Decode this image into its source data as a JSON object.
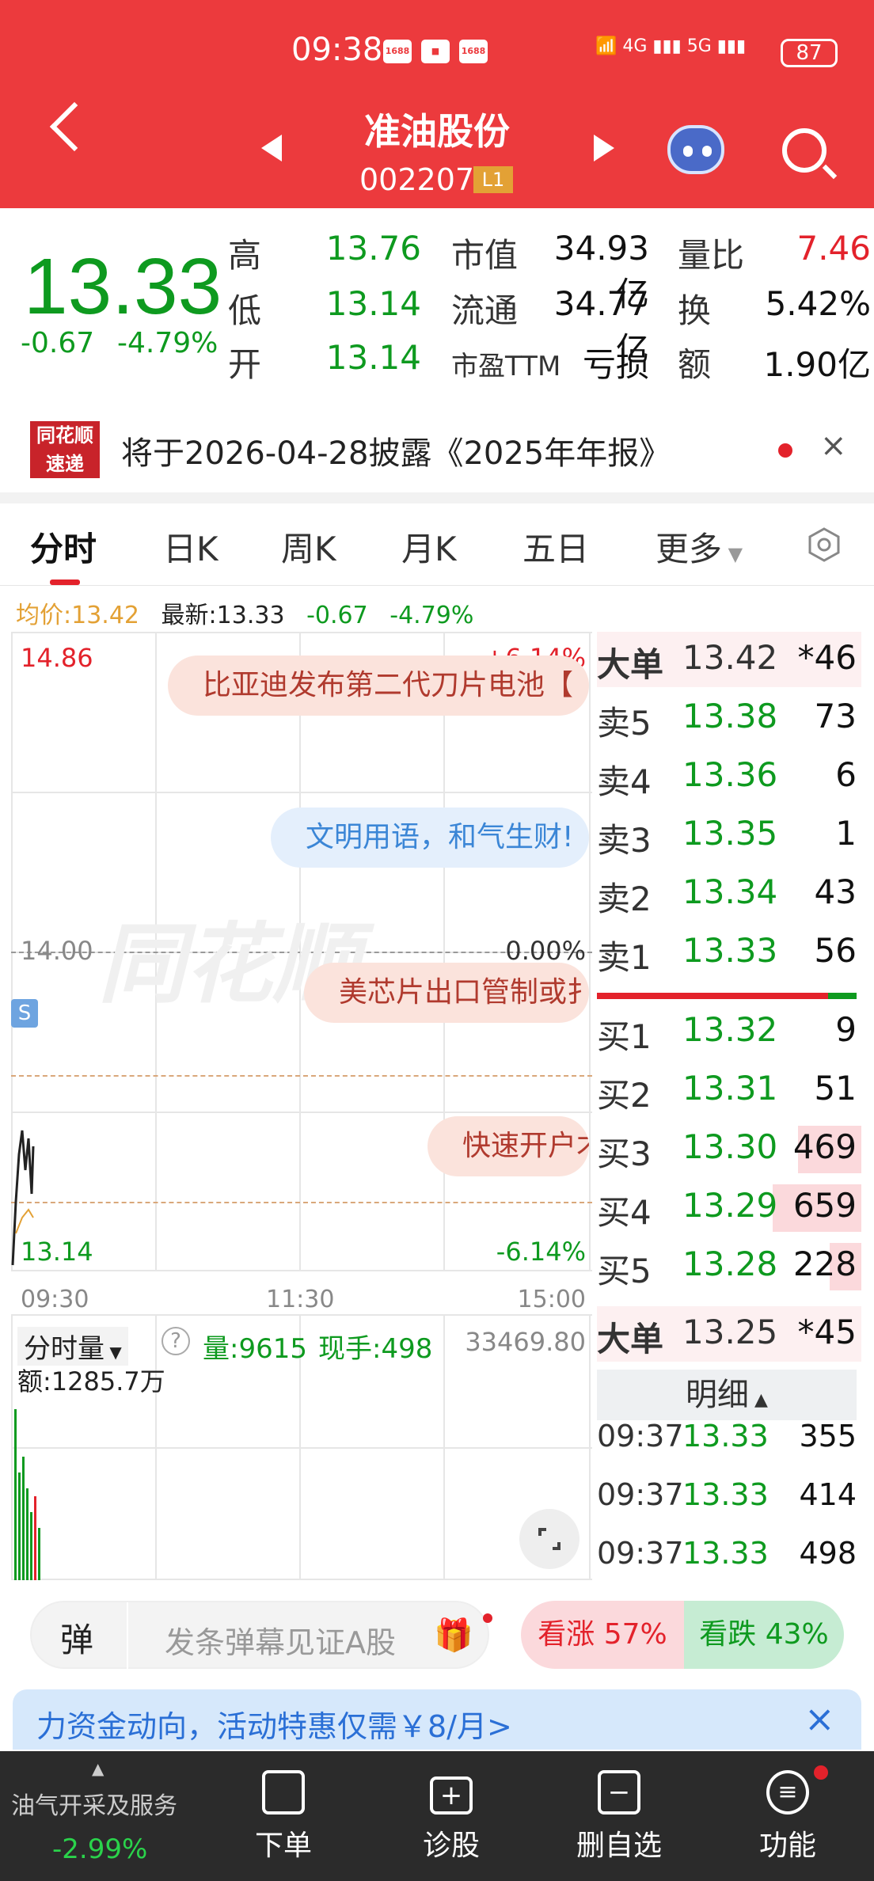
{
  "status": {
    "time": "09:38",
    "badge1": "1688",
    "badge2": "1688",
    "signal": "5G",
    "battery": "87"
  },
  "header": {
    "name": "准油股份",
    "code": "002207",
    "level": "L1"
  },
  "quote": {
    "price": "13.33",
    "change": "-0.67",
    "change_pct": "-4.79%",
    "high_label": "高",
    "high": "13.76",
    "low_label": "低",
    "low": "13.14",
    "open_label": "开",
    "open": "13.14",
    "mcap_label": "市值",
    "mcap": "34.93亿",
    "float_label": "流通",
    "float": "34.77亿",
    "pe_label": "市盈TTM",
    "pe": "亏损",
    "volratio_label": "量比",
    "volratio": "7.46",
    "turnover_label": "换",
    "turnover": "5.42%",
    "amount_label": "额",
    "amount": "1.90亿"
  },
  "notice": {
    "logo_top": "同花顺",
    "logo_bottom": "速递",
    "text": "将于2026-04-28披露《2025年年报》"
  },
  "tabs": [
    "分时",
    "日K",
    "周K",
    "月K",
    "五日",
    "更多"
  ],
  "info": {
    "avg_label": "均价:13.42",
    "latest": "最新:13.33",
    "chg": "-0.67",
    "pct": "-4.79%"
  },
  "chart": {
    "high": "14.86",
    "high_pct": "+6.14%",
    "mid": "14.00",
    "mid_pct": "0.00%",
    "low": "13.14",
    "low_pct": "-6.14%",
    "t_start": "09:30",
    "t_mid": "11:30",
    "t_end": "15:00",
    "marker": "S",
    "bubbles": [
      "比亚迪发布第二代刀片电池【",
      "文明用语，和气生财!",
      "美芯片出口管制或扌",
      "快速开户才"
    ]
  },
  "book": {
    "bigsell_label": "大单",
    "bigsell_price": "13.42",
    "bigsell_vol": "*46",
    "asks": [
      {
        "l": "卖5",
        "p": "13.38",
        "v": "73"
      },
      {
        "l": "卖4",
        "p": "13.36",
        "v": "6"
      },
      {
        "l": "卖3",
        "p": "13.35",
        "v": "1"
      },
      {
        "l": "卖2",
        "p": "13.34",
        "v": "43"
      },
      {
        "l": "卖1",
        "p": "13.33",
        "v": "56"
      }
    ],
    "bids": [
      {
        "l": "买1",
        "p": "13.32",
        "v": "9"
      },
      {
        "l": "买2",
        "p": "13.31",
        "v": "51"
      },
      {
        "l": "买3",
        "p": "13.30",
        "v": "469"
      },
      {
        "l": "买4",
        "p": "13.29",
        "v": "659"
      },
      {
        "l": "买5",
        "p": "13.28",
        "v": "228"
      }
    ],
    "bigbuy_label": "大单",
    "bigbuy_price": "13.25",
    "bigbuy_vol": "*45",
    "detail_label": "明细",
    "ticks": [
      {
        "t": "09:37",
        "p": "13.33",
        "v": "355"
      },
      {
        "t": "09:37",
        "p": "13.33",
        "v": "414"
      },
      {
        "t": "09:37",
        "p": "13.33",
        "v": "498"
      }
    ]
  },
  "volume": {
    "selector": "分时量",
    "vol": "量:9615",
    "hand": "现手:498",
    "max": "33469.80",
    "amount": "额:1285.7万"
  },
  "vote": {
    "danmu_icon": "弹",
    "placeholder": "发条弹幕见证A股",
    "up": "看涨 57%",
    "down": "看跌 43%"
  },
  "promo": {
    "text": "力资金动向，活动特惠仅需￥8/月>"
  },
  "nav": {
    "sector": "油气开采及服务",
    "sector_pct": "-2.99%",
    "items": [
      "下单",
      "诊股",
      "删自选",
      "功能"
    ]
  }
}
